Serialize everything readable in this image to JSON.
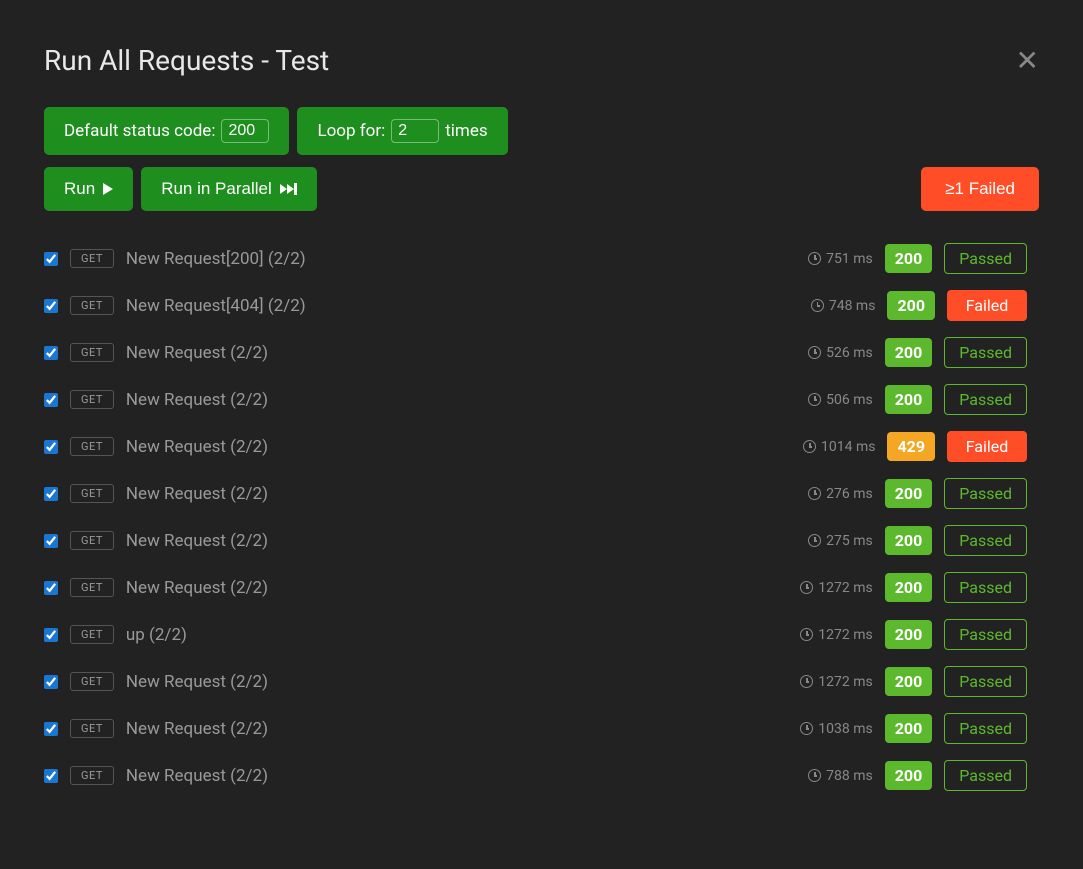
{
  "title": "Run All Requests - Test",
  "controls": {
    "statusLabel": "Default status code:",
    "statusValue": "200",
    "loopLabelPre": "Loop for:",
    "loopValue": "2",
    "loopLabelPost": "times",
    "runLabel": "Run",
    "runParallelLabel": "Run in Parallel",
    "failedLabel": "≥1 Failed"
  },
  "requests": [
    {
      "checked": true,
      "method": "GET",
      "name": "New Request[200] (2/2)",
      "time": "751 ms",
      "code": "200",
      "codeClass": "status-200",
      "result": "Passed",
      "resultClass": "result-passed"
    },
    {
      "checked": true,
      "method": "GET",
      "name": "New Request[404] (2/2)",
      "time": "748 ms",
      "code": "200",
      "codeClass": "status-200",
      "result": "Failed",
      "resultClass": "result-failed"
    },
    {
      "checked": true,
      "method": "GET",
      "name": "New Request (2/2)",
      "time": "526 ms",
      "code": "200",
      "codeClass": "status-200",
      "result": "Passed",
      "resultClass": "result-passed"
    },
    {
      "checked": true,
      "method": "GET",
      "name": "New Request (2/2)",
      "time": "506 ms",
      "code": "200",
      "codeClass": "status-200",
      "result": "Passed",
      "resultClass": "result-passed"
    },
    {
      "checked": true,
      "method": "GET",
      "name": "New Request (2/2)",
      "time": "1014 ms",
      "code": "429",
      "codeClass": "status-429",
      "result": "Failed",
      "resultClass": "result-failed"
    },
    {
      "checked": true,
      "method": "GET",
      "name": "New Request (2/2)",
      "time": "276 ms",
      "code": "200",
      "codeClass": "status-200",
      "result": "Passed",
      "resultClass": "result-passed"
    },
    {
      "checked": true,
      "method": "GET",
      "name": "New Request (2/2)",
      "time": "275 ms",
      "code": "200",
      "codeClass": "status-200",
      "result": "Passed",
      "resultClass": "result-passed"
    },
    {
      "checked": true,
      "method": "GET",
      "name": "New Request (2/2)",
      "time": "1272 ms",
      "code": "200",
      "codeClass": "status-200",
      "result": "Passed",
      "resultClass": "result-passed"
    },
    {
      "checked": true,
      "method": "GET",
      "name": "up (2/2)",
      "time": "1272 ms",
      "code": "200",
      "codeClass": "status-200",
      "result": "Passed",
      "resultClass": "result-passed"
    },
    {
      "checked": true,
      "method": "GET",
      "name": "New Request (2/2)",
      "time": "1272 ms",
      "code": "200",
      "codeClass": "status-200",
      "result": "Passed",
      "resultClass": "result-passed"
    },
    {
      "checked": true,
      "method": "GET",
      "name": "New Request (2/2)",
      "time": "1038 ms",
      "code": "200",
      "codeClass": "status-200",
      "result": "Passed",
      "resultClass": "result-passed"
    },
    {
      "checked": true,
      "method": "GET",
      "name": "New Request (2/2)",
      "time": "788 ms",
      "code": "200",
      "codeClass": "status-200",
      "result": "Passed",
      "resultClass": "result-passed"
    }
  ]
}
